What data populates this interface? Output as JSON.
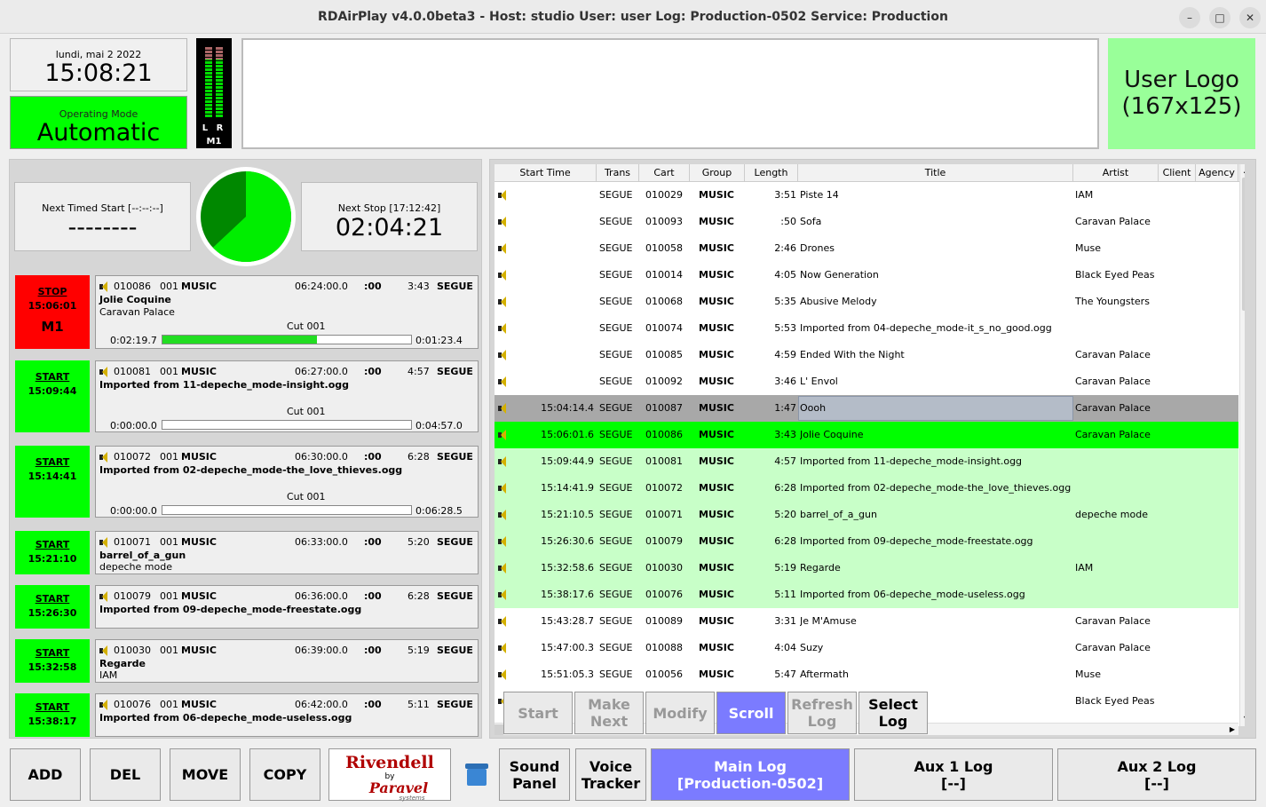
{
  "window": {
    "title": "RDAirPlay v4.0.0beta3 - Host: studio User: user Log: Production-0502 Service: Production"
  },
  "clock": {
    "date": "lundi, mai 2 2022",
    "time": "15:08:21"
  },
  "mode": {
    "label": "Operating Mode",
    "value": "Automatic"
  },
  "meter": {
    "lr": "L R",
    "name": "M1"
  },
  "logo": {
    "line1": "User Logo",
    "line2": "(167x125)"
  },
  "next_timed": {
    "label": "Next Timed Start [--:--:--]",
    "value": "--------"
  },
  "next_stop": {
    "label": "Next Stop [17:12:42]",
    "value": "02:04:21"
  },
  "pie": {
    "elapsed_fraction": 0.63
  },
  "slots": [
    {
      "btn": "STOP",
      "btn_time": "15:06:01",
      "btn_extra": "M1",
      "btn_color": "#ff0000",
      "cart": "010086",
      "cut": "001",
      "group": "MUSIC",
      "sched": "06:24:00.0",
      "talk": ":00",
      "len": "3:43",
      "trans": "SEGUE",
      "title": "Jolie Coquine",
      "artist": "Caravan Palace",
      "cutlabel": "Cut 001",
      "elapsed": "0:02:19.7",
      "remaining": "0:01:23.4",
      "progress": 0.62
    },
    {
      "btn": "START",
      "btn_time": "15:09:44",
      "btn_extra": "",
      "btn_color": "#00ff00",
      "cart": "010081",
      "cut": "001",
      "group": "MUSIC",
      "sched": "06:27:00.0",
      "talk": ":00",
      "len": "4:57",
      "trans": "SEGUE",
      "title": "Imported from 11-depeche_mode-insight.ogg",
      "artist": "",
      "cutlabel": "Cut 001",
      "elapsed": "0:00:00.0",
      "remaining": "0:04:57.0",
      "progress": 0
    },
    {
      "btn": "START",
      "btn_time": "15:14:41",
      "btn_extra": "",
      "btn_color": "#00ff00",
      "cart": "010072",
      "cut": "001",
      "group": "MUSIC",
      "sched": "06:30:00.0",
      "talk": ":00",
      "len": "6:28",
      "trans": "SEGUE",
      "title": "Imported from 02-depeche_mode-the_love_thieves.ogg",
      "artist": "",
      "cutlabel": "Cut 001",
      "elapsed": "0:00:00.0",
      "remaining": "0:06:28.5",
      "progress": 0
    },
    {
      "btn": "START",
      "btn_time": "15:21:10",
      "btn_extra": "",
      "btn_color": "#00ff00",
      "cart": "010071",
      "cut": "001",
      "group": "MUSIC",
      "sched": "06:33:00.0",
      "talk": ":00",
      "len": "5:20",
      "trans": "SEGUE",
      "title": "barrel_of_a_gun",
      "artist": "depeche mode"
    },
    {
      "btn": "START",
      "btn_time": "15:26:30",
      "btn_extra": "",
      "btn_color": "#00ff00",
      "cart": "010079",
      "cut": "001",
      "group": "MUSIC",
      "sched": "06:36:00.0",
      "talk": ":00",
      "len": "6:28",
      "trans": "SEGUE",
      "title": "Imported from 09-depeche_mode-freestate.ogg",
      "artist": ""
    },
    {
      "btn": "START",
      "btn_time": "15:32:58",
      "btn_extra": "",
      "btn_color": "#00ff00",
      "cart": "010030",
      "cut": "001",
      "group": "MUSIC",
      "sched": "06:39:00.0",
      "talk": ":00",
      "len": "5:19",
      "trans": "SEGUE",
      "title": "Regarde",
      "artist": "IAM"
    },
    {
      "btn": "START",
      "btn_time": "15:38:17",
      "btn_extra": "",
      "btn_color": "#00ff00",
      "cart": "010076",
      "cut": "001",
      "group": "MUSIC",
      "sched": "06:42:00.0",
      "talk": ":00",
      "len": "5:11",
      "trans": "SEGUE",
      "title": "Imported from 06-depeche_mode-useless.ogg",
      "artist": ""
    }
  ],
  "log": {
    "columns": [
      "Start Time",
      "Trans",
      "Cart",
      "Group",
      "Length",
      "Title",
      "Artist",
      "Client",
      "Agency"
    ],
    "rows": [
      {
        "start": "",
        "trans": "SEGUE",
        "cart": "010029",
        "group": "MUSIC",
        "len": "3:51",
        "title": "Piste 14",
        "artist": "IAM",
        "state": "normal"
      },
      {
        "start": "",
        "trans": "SEGUE",
        "cart": "010093",
        "group": "MUSIC",
        "len": ":50",
        "title": "Sofa",
        "artist": "Caravan Palace",
        "state": "normal"
      },
      {
        "start": "",
        "trans": "SEGUE",
        "cart": "010058",
        "group": "MUSIC",
        "len": "2:46",
        "title": "Drones",
        "artist": "Muse",
        "state": "normal"
      },
      {
        "start": "",
        "trans": "SEGUE",
        "cart": "010014",
        "group": "MUSIC",
        "len": "4:05",
        "title": "Now Generation",
        "artist": "Black Eyed Peas",
        "state": "normal"
      },
      {
        "start": "",
        "trans": "SEGUE",
        "cart": "010068",
        "group": "MUSIC",
        "len": "5:35",
        "title": "Abusive Melody",
        "artist": "The Youngsters",
        "state": "normal"
      },
      {
        "start": "",
        "trans": "SEGUE",
        "cart": "010074",
        "group": "MUSIC",
        "len": "5:53",
        "title": "Imported from 04-depeche_mode-it_s_no_good.ogg",
        "artist": "",
        "state": "normal"
      },
      {
        "start": "",
        "trans": "SEGUE",
        "cart": "010085",
        "group": "MUSIC",
        "len": "4:59",
        "title": "Ended With the Night",
        "artist": "Caravan Palace",
        "state": "normal"
      },
      {
        "start": "",
        "trans": "SEGUE",
        "cart": "010092",
        "group": "MUSIC",
        "len": "3:46",
        "title": "L' Envol",
        "artist": "Caravan Palace",
        "state": "normal"
      },
      {
        "start": "15:04:14.4",
        "trans": "SEGUE",
        "cart": "010087",
        "group": "MUSIC",
        "len": "1:47",
        "title": "Oooh",
        "artist": "Caravan Palace",
        "state": "played"
      },
      {
        "start": "15:06:01.6",
        "trans": "SEGUE",
        "cart": "010086",
        "group": "MUSIC",
        "len": "3:43",
        "title": "Jolie Coquine",
        "artist": "Caravan Palace",
        "state": "playing"
      },
      {
        "start": "15:09:44.9",
        "trans": "SEGUE",
        "cart": "010081",
        "group": "MUSIC",
        "len": "4:57",
        "title": "Imported from 11-depeche_mode-insight.ogg",
        "artist": "",
        "state": "next"
      },
      {
        "start": "15:14:41.9",
        "trans": "SEGUE",
        "cart": "010072",
        "group": "MUSIC",
        "len": "6:28",
        "title": "Imported from 02-depeche_mode-the_love_thieves.ogg",
        "artist": "",
        "state": "next"
      },
      {
        "start": "15:21:10.5",
        "trans": "SEGUE",
        "cart": "010071",
        "group": "MUSIC",
        "len": "5:20",
        "title": "barrel_of_a_gun",
        "artist": "depeche mode",
        "state": "next"
      },
      {
        "start": "15:26:30.6",
        "trans": "SEGUE",
        "cart": "010079",
        "group": "MUSIC",
        "len": "6:28",
        "title": "Imported from 09-depeche_mode-freestate.ogg",
        "artist": "",
        "state": "next"
      },
      {
        "start": "15:32:58.6",
        "trans": "SEGUE",
        "cart": "010030",
        "group": "MUSIC",
        "len": "5:19",
        "title": "Regarde",
        "artist": "IAM",
        "state": "next"
      },
      {
        "start": "15:38:17.6",
        "trans": "SEGUE",
        "cart": "010076",
        "group": "MUSIC",
        "len": "5:11",
        "title": "Imported from 06-depeche_mode-useless.ogg",
        "artist": "",
        "state": "next"
      },
      {
        "start": "15:43:28.7",
        "trans": "SEGUE",
        "cart": "010089",
        "group": "MUSIC",
        "len": "3:31",
        "title": "Je M'Amuse",
        "artist": "Caravan Palace",
        "state": "normal"
      },
      {
        "start": "15:47:00.3",
        "trans": "SEGUE",
        "cart": "010088",
        "group": "MUSIC",
        "len": "4:04",
        "title": "Suzy",
        "artist": "Caravan Palace",
        "state": "normal"
      },
      {
        "start": "15:51:05.3",
        "trans": "SEGUE",
        "cart": "010056",
        "group": "MUSIC",
        "len": "5:47",
        "title": "Aftermath",
        "artist": "Muse",
        "state": "normal"
      },
      {
        "start": "",
        "trans": "",
        "cart": "",
        "group": "",
        "len": "",
        "title": "",
        "artist": "Black Eyed Peas",
        "state": "normal"
      }
    ]
  },
  "log_buttons": {
    "start": "Start",
    "make_next_1": "Make",
    "make_next_2": "Next",
    "modify": "Modify",
    "scroll": "Scroll",
    "refresh_1": "Refresh",
    "refresh_2": "Log",
    "select_1": "Select",
    "select_2": "Log"
  },
  "bottom": {
    "add": "ADD",
    "del": "DEL",
    "move": "MOVE",
    "copy": "COPY",
    "riv": "Rivendell",
    "by": "by",
    "paravel": "Paravel",
    "systems": "systems",
    "sound_1": "Sound",
    "sound_2": "Panel",
    "voice_1": "Voice",
    "voice_2": "Tracker",
    "main_1": "Main Log",
    "main_2": "[Production-0502]",
    "aux1_1": "Aux 1 Log",
    "aux1_2": "[--]",
    "aux2_1": "Aux 2 Log",
    "aux2_2": "[--]"
  },
  "colors": {
    "playing": "#00ff00",
    "next": "#c8ffc8",
    "played": "#a8a8a8",
    "accent": "#7b7bff"
  }
}
